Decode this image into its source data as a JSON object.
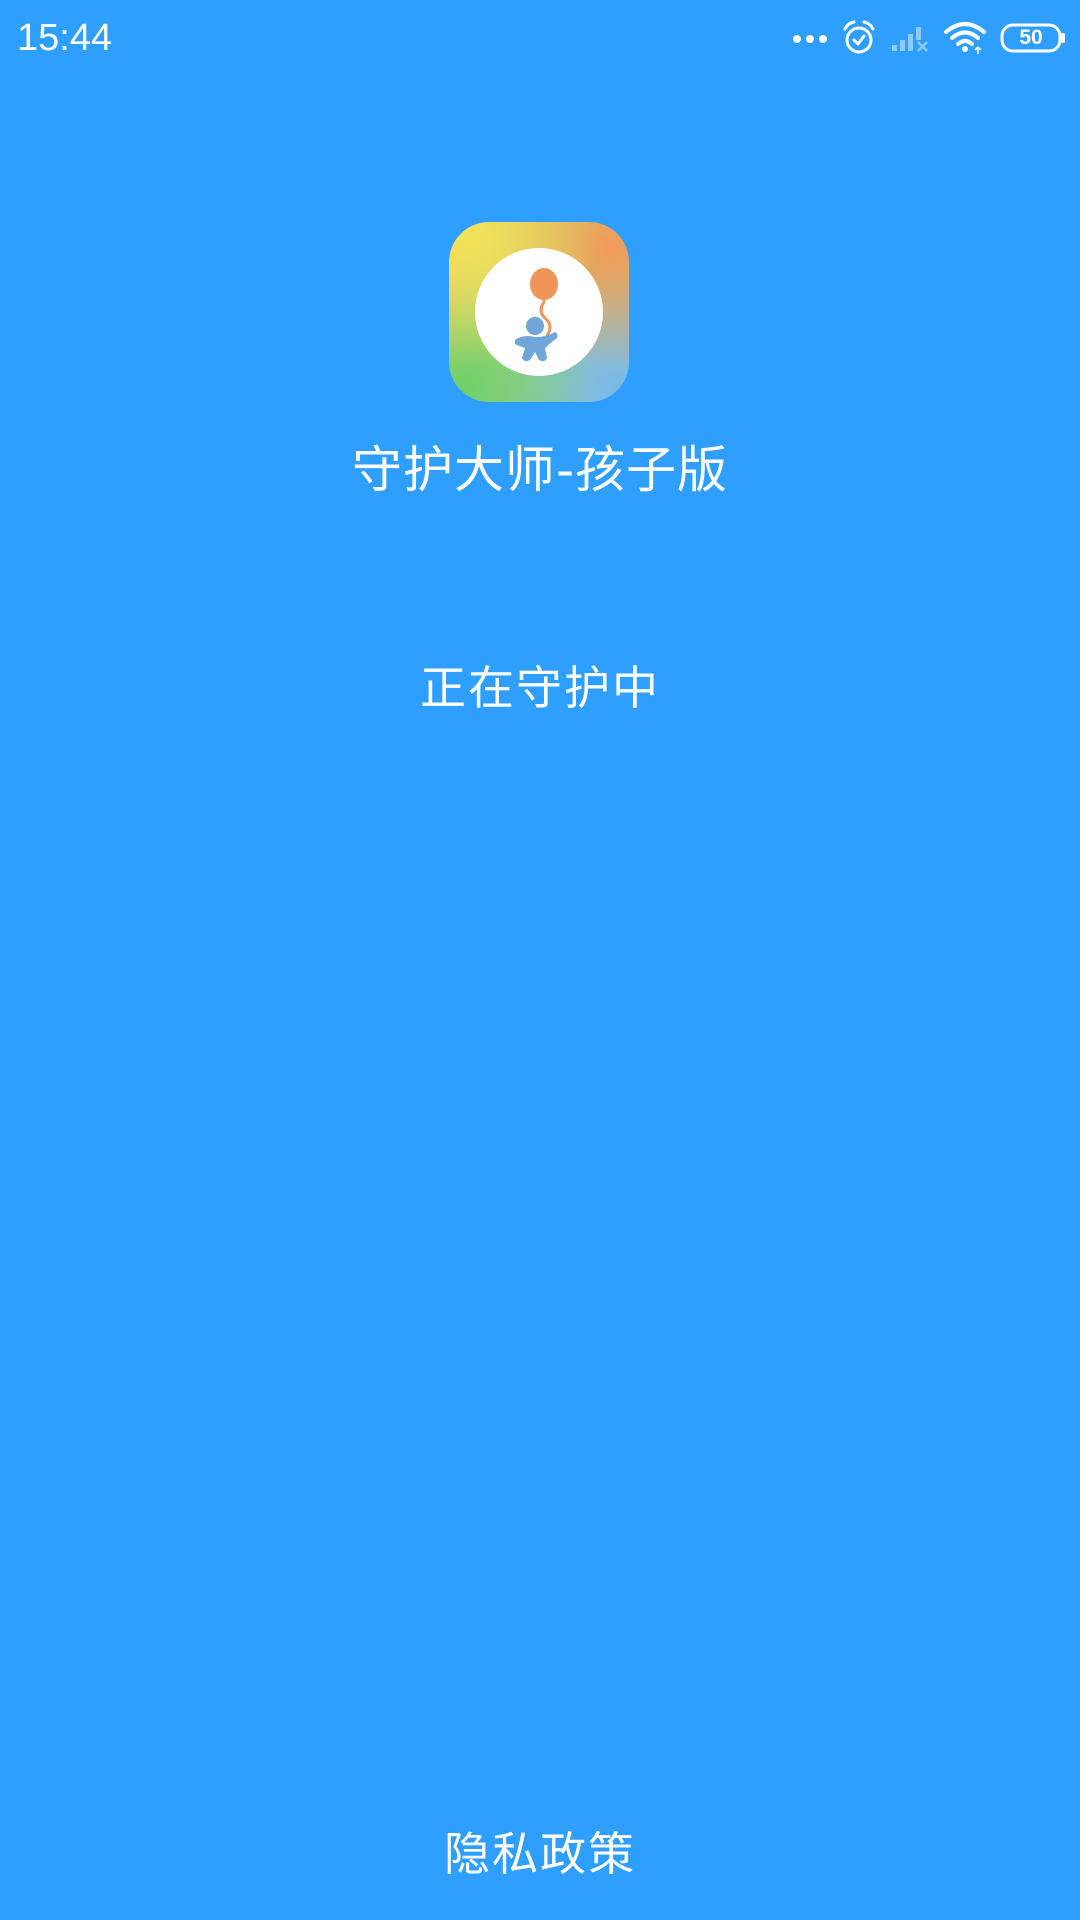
{
  "status_bar": {
    "time": "15:44",
    "battery_level": "50",
    "icons": [
      "more-dots-icon",
      "alarm-icon",
      "signal-no-service-icon",
      "wifi-icon",
      "battery-icon"
    ]
  },
  "app": {
    "icon": "balloon-child-app-icon",
    "title": "守护大师-孩子版",
    "status": "正在守护中"
  },
  "footer": {
    "privacy_link": "隐私政策"
  },
  "colors": {
    "background": "#2e9ffe",
    "text": "#ffffff",
    "balloon": "#f0955a",
    "child": "#6fa5d8"
  }
}
